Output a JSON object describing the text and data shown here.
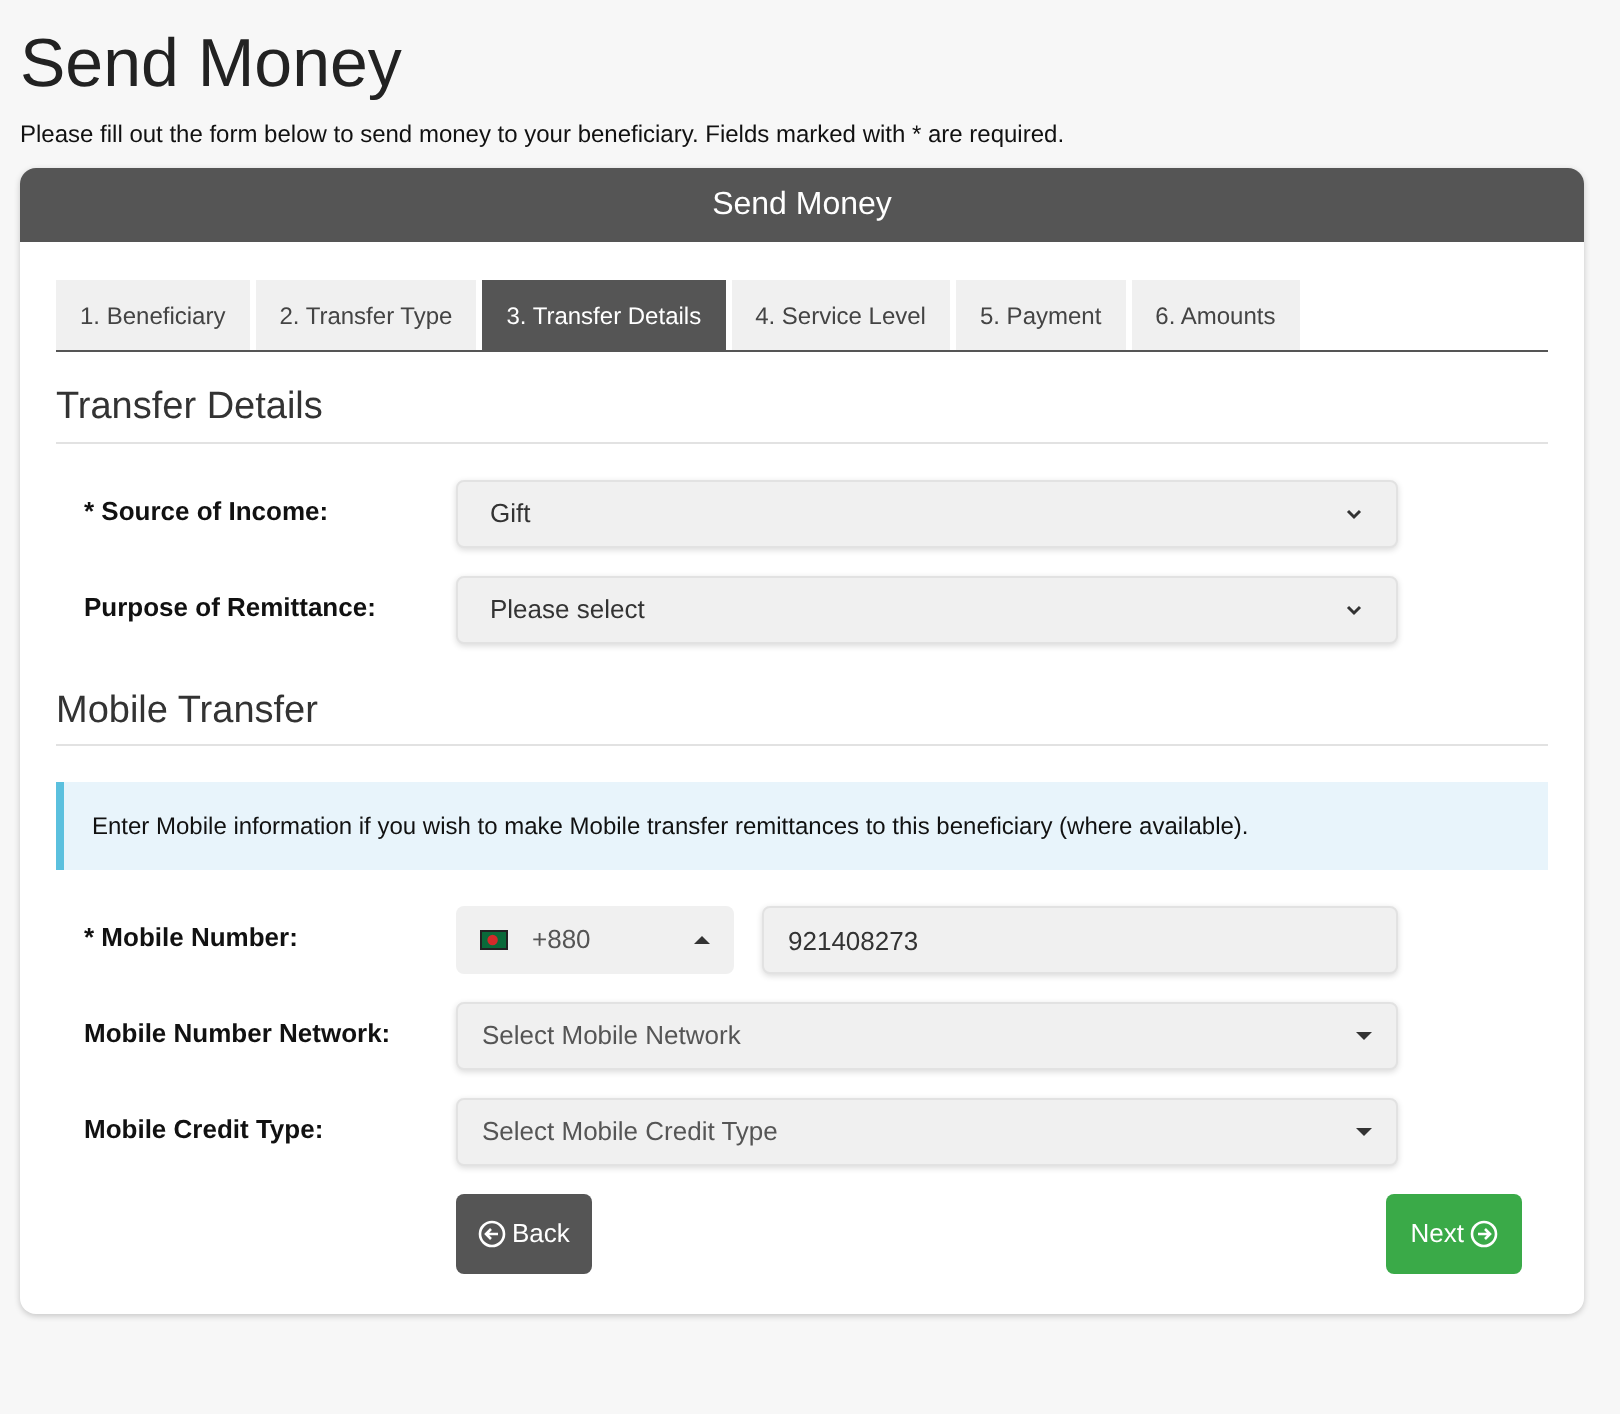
{
  "page": {
    "title": "Send Money",
    "intro": "Please fill out the form below to send money to your beneficiary. Fields marked with * are required."
  },
  "card": {
    "title": "Send Money"
  },
  "tabs": [
    {
      "label": "1. Beneficiary",
      "selected": false
    },
    {
      "label": "2. Transfer Type",
      "selected": false
    },
    {
      "label": "3. Transfer Details",
      "selected": true
    },
    {
      "label": "4. Service Level",
      "selected": false
    },
    {
      "label": "5. Payment",
      "selected": false
    },
    {
      "label": "6. Amounts",
      "selected": false
    }
  ],
  "sections": [
    {
      "heading": "Transfer Details",
      "fields": [
        {
          "kind": "select",
          "label": "* Source of Income:",
          "value": "Gift"
        },
        {
          "kind": "select",
          "label": "Purpose of Remittance:",
          "value": "Please select"
        }
      ]
    },
    {
      "heading": "Mobile Transfer",
      "info": "Enter Mobile information if you wish to make Mobile transfer remittances to this beneficiary (where available).",
      "fields": [
        {
          "kind": "phone",
          "label": "* Mobile Number:",
          "code": "+880",
          "value": "921408273"
        },
        {
          "kind": "dropdown",
          "label": "Mobile Number Network:",
          "placeholder": "Select Mobile Network"
        },
        {
          "kind": "dropdown",
          "label": "Mobile Credit Type:",
          "placeholder": "Select Mobile Credit Type"
        }
      ]
    }
  ],
  "buttons": {
    "back": "Back",
    "next": "Next"
  }
}
